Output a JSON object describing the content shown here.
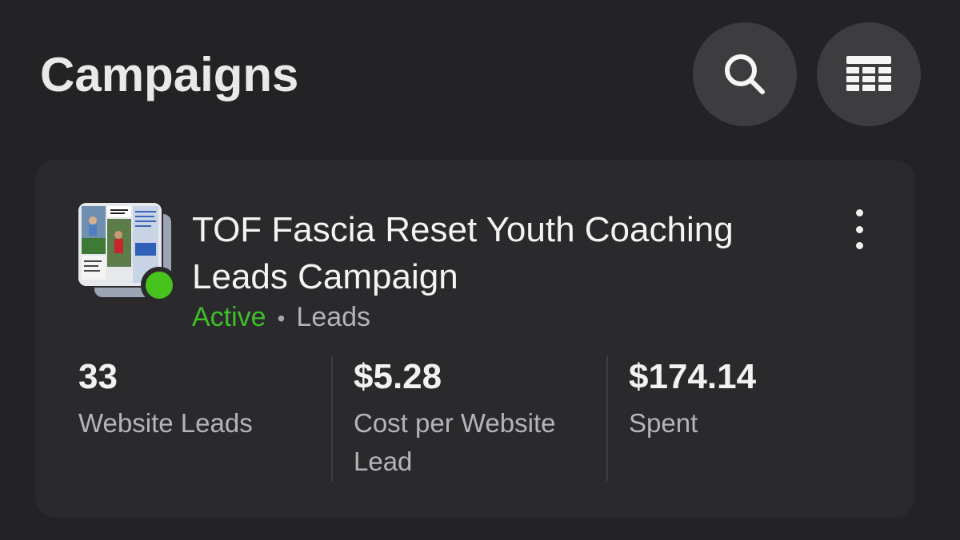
{
  "header": {
    "title": "Campaigns",
    "search_icon": "search-icon",
    "table_icon": "table-view-icon"
  },
  "campaign": {
    "name": "TOF Fascia Reset Youth Coaching Leads Campaign",
    "status": "Active",
    "separator": "•",
    "objective": "Leads",
    "status_color": "#48c21c",
    "more_icon": "more-vertical-icon",
    "metrics": [
      {
        "value": "33",
        "label": "Website Leads"
      },
      {
        "value": "$5.28",
        "label": "Cost per Website Lead"
      },
      {
        "value": "$174.14",
        "label": "Spent"
      }
    ]
  },
  "colors": {
    "background": "#232325",
    "card": "#2a2a2c",
    "button": "#3d3d40",
    "active_green": "#3fbf2a"
  }
}
